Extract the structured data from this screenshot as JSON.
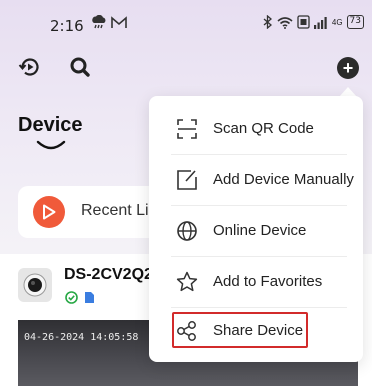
{
  "status_bar": {
    "time": "2:16",
    "network_tag": "4G",
    "battery": "73"
  },
  "toolbar": {
    "history_icon": "history-icon",
    "search_icon": "search-icon",
    "add_icon": "plus-icon"
  },
  "page": {
    "title": "Device"
  },
  "recent": {
    "label": "Recent Li"
  },
  "device": {
    "name": "DS-2CV2Q2",
    "timestamp": "04-26-2024 14:05:58"
  },
  "menu": {
    "items": [
      {
        "label": "Scan QR Code",
        "icon": "scan-qr-icon"
      },
      {
        "label": "Add Device Manually",
        "icon": "edit-icon"
      },
      {
        "label": "Online Device",
        "icon": "globe-icon"
      },
      {
        "label": "Add to Favorites",
        "icon": "star-icon"
      },
      {
        "label": "Share Device",
        "icon": "share-icon"
      }
    ]
  },
  "colors": {
    "accent_orange": "#f05a3a",
    "highlight_red": "#d22b2b",
    "online_green": "#27a845",
    "storage_blue": "#3a7de0"
  }
}
